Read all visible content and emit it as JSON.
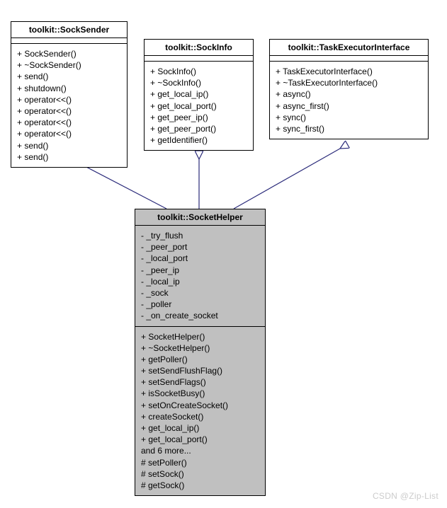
{
  "diagram": {
    "watermark": "CSDN @Zip-List",
    "classes": {
      "sockSender": {
        "name": "toolkit::SockSender",
        "members": [
          "+ SockSender()",
          "+ ~SockSender()",
          "+ send()",
          "+ shutdown()",
          "+ operator<<()",
          "+ operator<<()",
          "+ operator<<()",
          "+ operator<<()",
          "+ send()",
          "+ send()"
        ]
      },
      "sockInfo": {
        "name": "toolkit::SockInfo",
        "members": [
          "+ SockInfo()",
          "+ ~SockInfo()",
          "+ get_local_ip()",
          "+ get_local_port()",
          "+ get_peer_ip()",
          "+ get_peer_port()",
          "+ getIdentifier()"
        ]
      },
      "taskExecutor": {
        "name": "toolkit::TaskExecutorInterface",
        "members": [
          "+ TaskExecutorInterface()",
          "+ ~TaskExecutorInterface()",
          "+ async()",
          "+ async_first()",
          "+ sync()",
          "+ sync_first()"
        ]
      },
      "socketHelper": {
        "name": "toolkit::SocketHelper",
        "privates": [
          "- _try_flush",
          "- _peer_port",
          "- _local_port",
          "- _peer_ip",
          "- _local_ip",
          "- _sock",
          "- _poller",
          "- _on_create_socket"
        ],
        "publics": [
          "+ SocketHelper()",
          "+ ~SocketHelper()",
          "+ getPoller()",
          "+ setSendFlushFlag()",
          "+ setSendFlags()",
          "+ isSocketBusy()",
          "+ setOnCreateSocket()",
          "+ createSocket()",
          "+ get_local_ip()",
          "+ get_local_port()",
          "and 6 more...",
          "# setPoller()",
          "# setSock()",
          "# getSock()"
        ]
      }
    }
  }
}
